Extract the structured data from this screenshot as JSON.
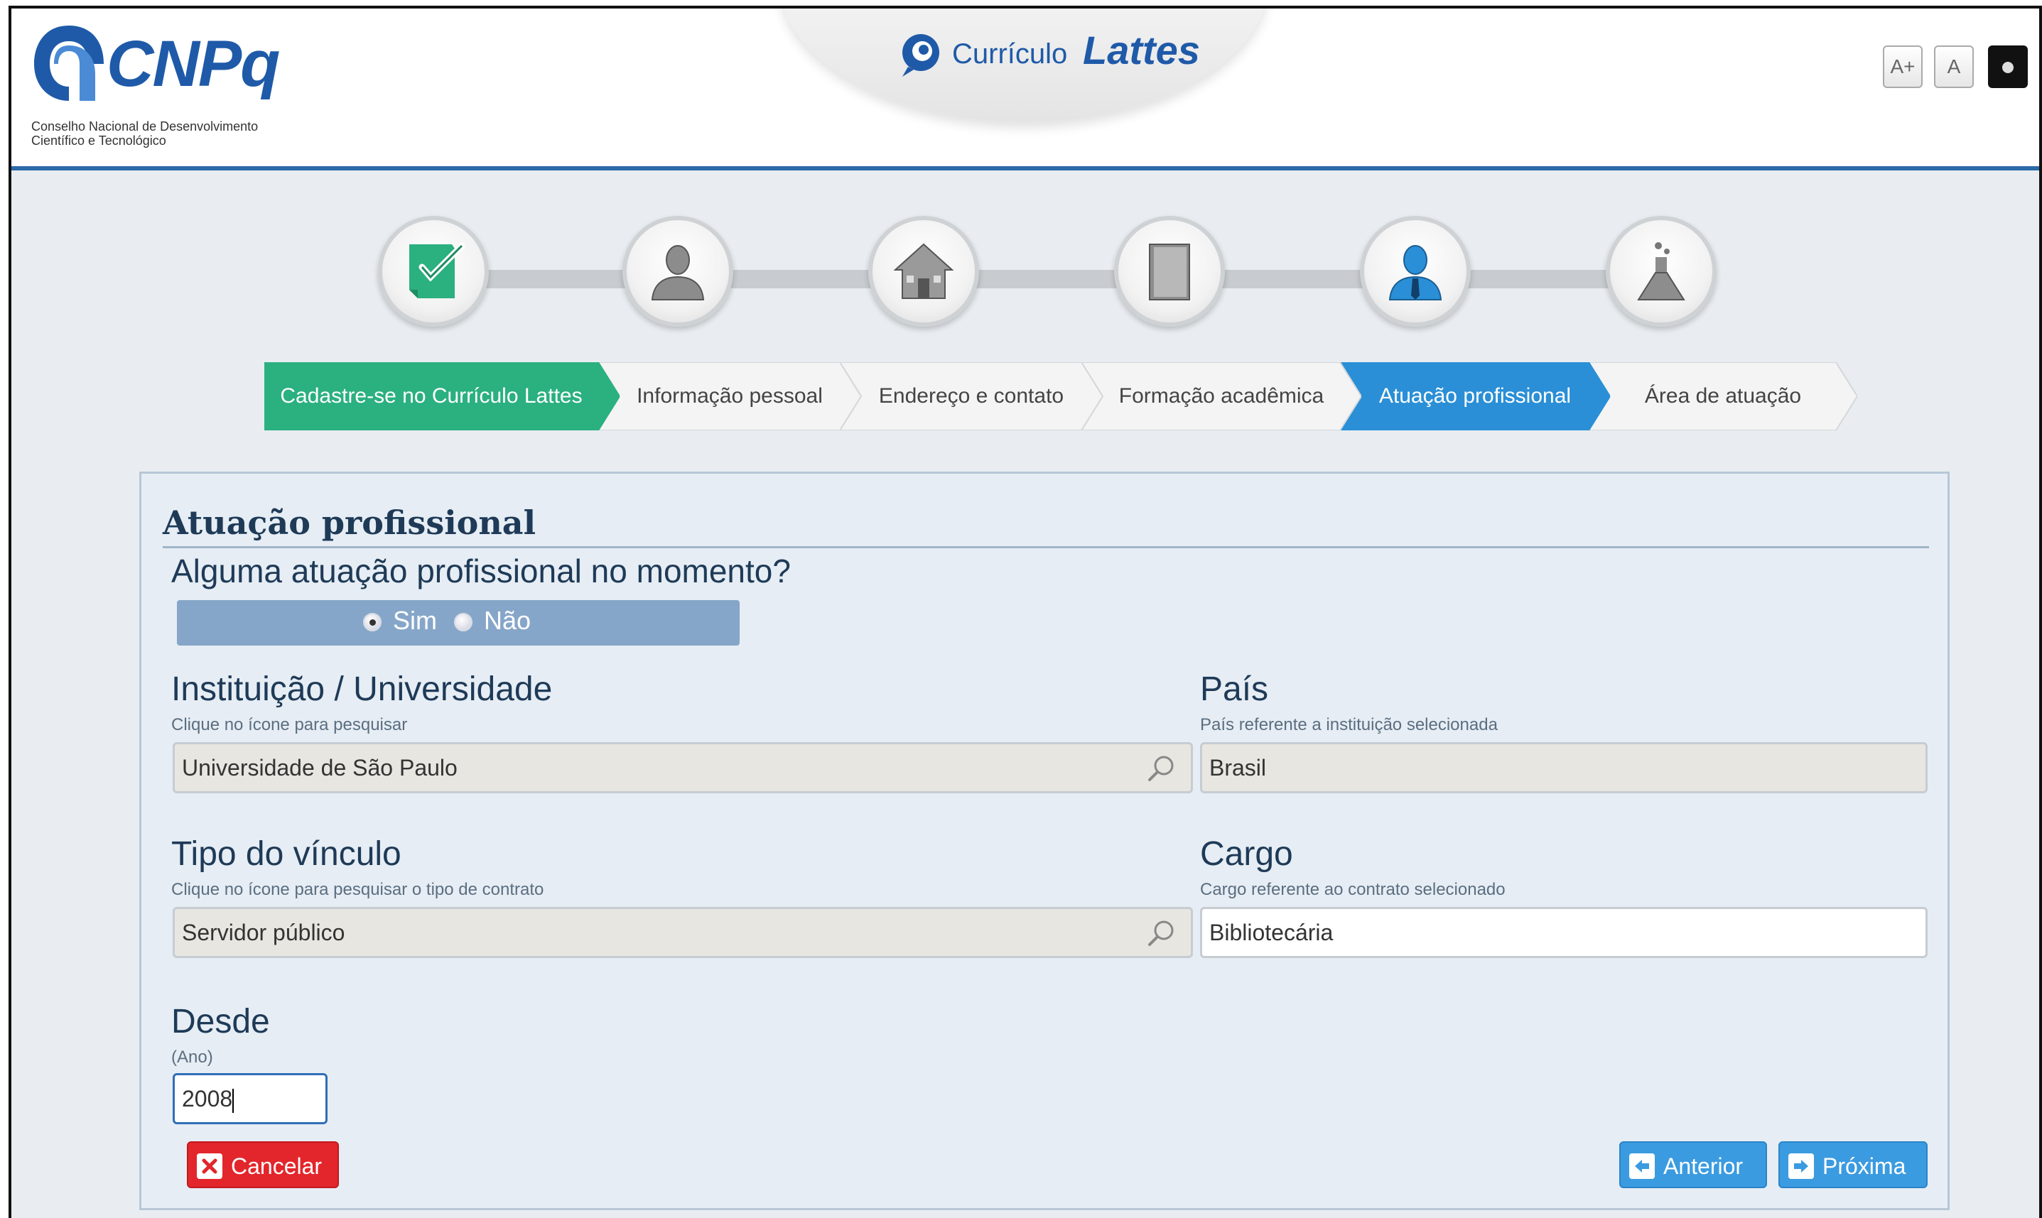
{
  "header": {
    "logo_text": "CNPq",
    "logo_subtitle_1": "Conselho Nacional de Desenvolvimento",
    "logo_subtitle_2": "Científico e Tecnológico",
    "app_label_1": "Currículo",
    "app_label_2": "Lattes",
    "font_increase_label": "A+",
    "font_normal_label": "A"
  },
  "steps": [
    {
      "label": "Cadastre-se no Currículo Lattes",
      "icon": "checklist-icon",
      "state": "done"
    },
    {
      "label": "Informação pessoal",
      "icon": "person-icon",
      "state": "pending"
    },
    {
      "label": "Endereço e contato",
      "icon": "house-icon",
      "state": "pending"
    },
    {
      "label": "Formação acadêmica",
      "icon": "book-icon",
      "state": "pending"
    },
    {
      "label": "Atuação profissional",
      "icon": "professional-icon",
      "state": "active"
    },
    {
      "label": "Área de atuação",
      "icon": "flask-icon",
      "state": "pending"
    }
  ],
  "colors": {
    "done": "#2bb07f",
    "active": "#2a8fd6",
    "pending": "#f4f4f4",
    "header_rule": "#2c6aa8",
    "cancel": "#e2262b",
    "nav_button": "#3b9be0"
  },
  "form": {
    "title": "Atuação profissional",
    "question": "Alguma atuação profissional no momento?",
    "radio_yes": "Sim",
    "radio_no": "Não",
    "radio_selected": "Sim",
    "institution": {
      "label": "Instituição / Universidade",
      "hint": "Clique no ícone para pesquisar",
      "value": "Universidade de São Paulo"
    },
    "country": {
      "label": "País",
      "hint": "País referente a instituição selecionada",
      "value": "Brasil"
    },
    "bond_type": {
      "label": "Tipo do vínculo",
      "hint": "Clique no ícone para pesquisar o tipo de contrato",
      "value": "Servidor público"
    },
    "position": {
      "label": "Cargo",
      "hint": "Cargo referente ao contrato selecionado",
      "value": "Bibliotecária"
    },
    "since": {
      "label": "Desde",
      "hint": "(Ano)",
      "value": "2008"
    }
  },
  "buttons": {
    "cancel": "Cancelar",
    "previous": "Anterior",
    "next": "Próxima"
  }
}
